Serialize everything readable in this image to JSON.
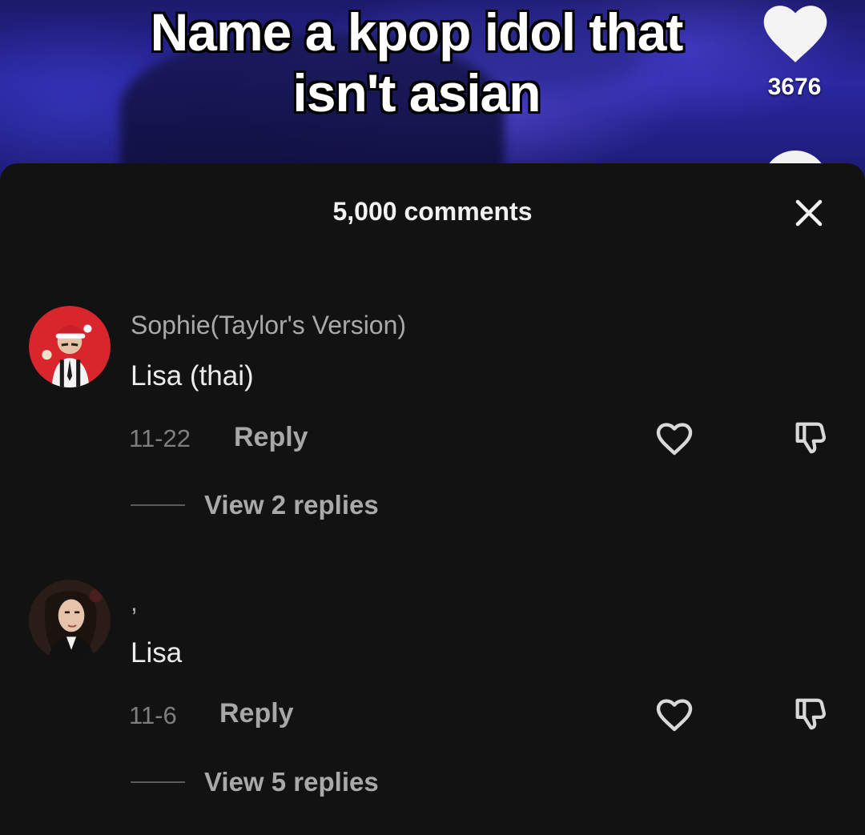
{
  "video": {
    "caption_line1": "Name a kpop idol that",
    "caption_line2": "isn't asian",
    "like_count": "3676"
  },
  "comments_panel": {
    "title": "5,000 comments",
    "close_icon": "close-icon"
  },
  "comments": [
    {
      "username": "Sophie(Taylor's Version)",
      "text": "Lisa (thai)",
      "date": "11-22",
      "reply_label": "Reply",
      "view_replies": "View 2 replies"
    },
    {
      "username": ",",
      "text": "Lisa",
      "date": "11-6",
      "reply_label": "Reply",
      "view_replies": "View 5 replies"
    }
  ],
  "colors": {
    "sheet_background": "#121212",
    "primary_text": "#ececec",
    "secondary_text": "#a9a9a9",
    "accent_video": "#2a27a0"
  }
}
